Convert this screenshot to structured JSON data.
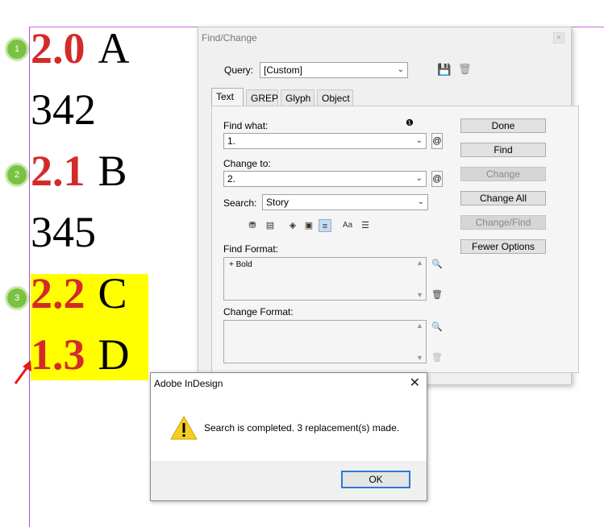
{
  "document": {
    "lines": [
      {
        "num": "2.0",
        "text": "A"
      },
      {
        "num": "",
        "text": "342"
      },
      {
        "num": "2.1",
        "text": "B"
      },
      {
        "num": "",
        "text": "345"
      },
      {
        "num": "2.2",
        "text": "C"
      },
      {
        "num": "1.3",
        "text": "D"
      }
    ],
    "markers": [
      "1",
      "2",
      "3"
    ],
    "colors": {
      "number": "#d42a2a",
      "highlight": "#ffff00",
      "marker": "#7cc242",
      "guide": "#b44ad6",
      "arrow": "#e21b1b"
    }
  },
  "find_change": {
    "title": "Find/Change",
    "query_label": "Query:",
    "query_value": "[Custom]",
    "tabs": [
      "Text",
      "GREP",
      "Glyph",
      "Object"
    ],
    "find_what_label": "Find what:",
    "find_what_value": "1.",
    "change_to_label": "Change to:",
    "change_to_value": "2.",
    "search_label": "Search:",
    "search_value": "Story",
    "find_format_label": "Find Format:",
    "find_format_value": "+ Bold",
    "change_format_label": "Change Format:",
    "option_icons": [
      "locked-layers-icon",
      "locked-stories-icon",
      "hidden-layers-icon",
      "master-pages-icon",
      "footnotes-icon",
      "case-sensitive-icon",
      "whole-word-icon"
    ],
    "buttons": {
      "done": "Done",
      "find": "Find",
      "change": "Change",
      "change_all": "Change All",
      "change_find": "Change/Find",
      "fewer_options": "Fewer Options"
    }
  },
  "alert": {
    "title": "Adobe InDesign",
    "message": "Search is completed.  3 replacement(s) made.",
    "ok": "OK"
  }
}
